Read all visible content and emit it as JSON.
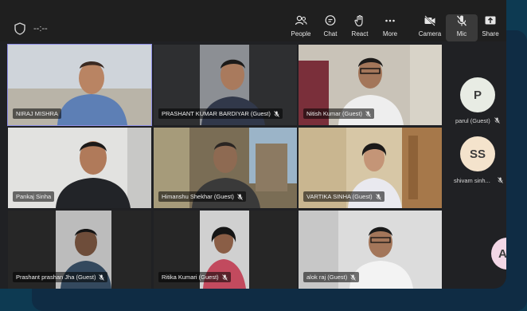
{
  "meeting": {
    "timer": "--:--"
  },
  "toolbar": {
    "people": "People",
    "chat": "Chat",
    "react": "React",
    "more": "More",
    "camera": "Camera",
    "mic": "Mic",
    "share": "Share"
  },
  "participants": [
    "NIRAJ MISHRA",
    "PRASHANT KUMAR BARDIYAR (Guest)",
    "Nitish Kumar (Guest)",
    "Pankaj Sinha",
    "Himanshu Shekhar (Guest)",
    "VARTIKA SINHA (Guest)",
    "Prashant prashan Jha (Guest)",
    "Ritika Kumari (Guest)",
    "alok raj (Guest)"
  ],
  "side_panel": {
    "p1_initials": "P",
    "p1_label": "parul (Guest)",
    "p2_initials": "SS",
    "p2_label": "shivam sinh...",
    "p3_initials": "A"
  },
  "colors": {
    "background": "#0d3a52",
    "tile_highlight": "#8e8fe6",
    "avatar_p": "#e8ece4",
    "avatar_ss": "#f4e3cc",
    "avatar_a": "#f2d7e6"
  }
}
